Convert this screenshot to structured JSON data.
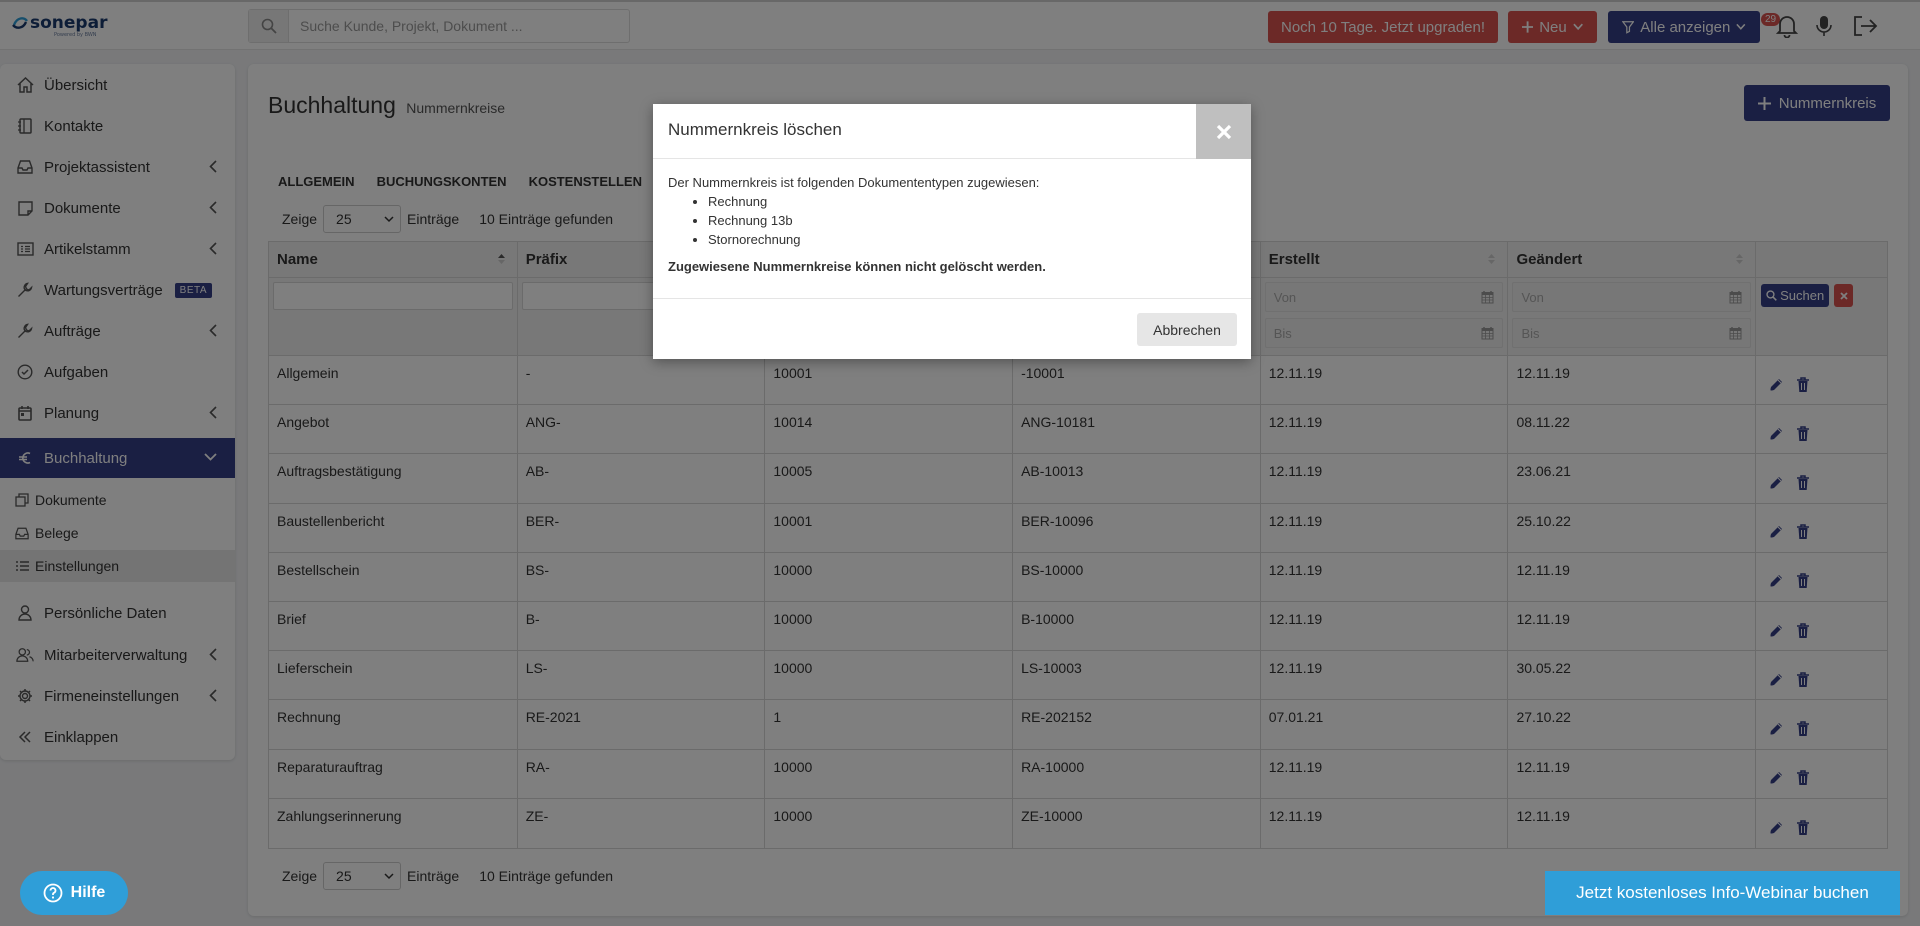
{
  "app": {
    "logo": "sonepar",
    "logo_sub": "Powered by BWN"
  },
  "search": {
    "placeholder": "Suche Kunde, Projekt, Dokument ..."
  },
  "topbar": {
    "upgrade_label": "Noch 10 Tage. Jetzt upgraden!",
    "new_label": "Neu",
    "filter_label": "Alle anzeigen",
    "notification_count": "29"
  },
  "sidebar": {
    "items": [
      {
        "label": "Übersicht",
        "icon": "home-icon"
      },
      {
        "label": "Kontakte",
        "icon": "address-book-icon"
      },
      {
        "label": "Projektassistent",
        "icon": "inbox-icon"
      },
      {
        "label": "Dokumente",
        "icon": "note-icon"
      },
      {
        "label": "Artikelstamm",
        "icon": "list-icon"
      },
      {
        "label": "Wartungsverträge",
        "icon": "wrench-icon",
        "badge": "BETA"
      },
      {
        "label": "Aufträge",
        "icon": "wrench-icon"
      },
      {
        "label": "Aufgaben",
        "icon": "check-circle-icon"
      },
      {
        "label": "Planung",
        "icon": "calendar-icon"
      },
      {
        "label": "Buchhaltung",
        "icon": "euro-icon"
      }
    ],
    "sub_items": [
      {
        "label": "Dokumente",
        "icon": "copy-icon"
      },
      {
        "label": "Belege",
        "icon": "inbox-icon"
      },
      {
        "label": "Einstellungen",
        "icon": "list-icon"
      }
    ],
    "bottom_items": [
      {
        "label": "Persönliche Daten",
        "icon": "user-icon"
      },
      {
        "label": "Mitarbeiterverwaltung",
        "icon": "users-icon"
      },
      {
        "label": "Firmeneinstellungen",
        "icon": "gear-icon"
      },
      {
        "label": "Einklappen",
        "icon": "double-chevron-left-icon"
      }
    ]
  },
  "page": {
    "title": "Buchhaltung",
    "subtitle": "Nummernkreise",
    "add_label": "Nummernkreis"
  },
  "tabs": [
    "ALLGEMEIN",
    "BUCHUNGSKONTEN",
    "KOSTENSTELLEN"
  ],
  "paging": {
    "show_label": "Zeige",
    "page_size": "25",
    "entries_label": "Einträge",
    "found_label": "10 Einträge gefunden"
  },
  "table": {
    "headers": [
      "Name",
      "Präfix",
      "",
      "",
      "Erstellt",
      "Geändert"
    ],
    "filter": {
      "from_placeholder": "Von",
      "to_placeholder": "Bis",
      "search_label": "Suchen"
    },
    "rows": [
      [
        "Allgemein",
        "-",
        "10001",
        "-10001",
        "12.11.19",
        "12.11.19"
      ],
      [
        "Angebot",
        "ANG-",
        "10014",
        "ANG-10181",
        "12.11.19",
        "08.11.22"
      ],
      [
        "Auftragsbestätigung",
        "AB-",
        "10005",
        "AB-10013",
        "12.11.19",
        "23.06.21"
      ],
      [
        "Baustellenbericht",
        "BER-",
        "10001",
        "BER-10096",
        "12.11.19",
        "25.10.22"
      ],
      [
        "Bestellschein",
        "BS-",
        "10000",
        "BS-10000",
        "12.11.19",
        "12.11.19"
      ],
      [
        "Brief",
        "B-",
        "10000",
        "B-10000",
        "12.11.19",
        "12.11.19"
      ],
      [
        "Lieferschein",
        "LS-",
        "10000",
        "LS-10003",
        "12.11.19",
        "30.05.22"
      ],
      [
        "Rechnung",
        "RE-2021",
        "1",
        "RE-202152",
        "07.01.21",
        "27.10.22"
      ],
      [
        "Reparaturauftrag",
        "RA-",
        "10000",
        "RA-10000",
        "12.11.19",
        "12.11.19"
      ],
      [
        "Zahlungserinnerung",
        "ZE-",
        "10000",
        "ZE-10000",
        "12.11.19",
        "12.11.19"
      ]
    ]
  },
  "help_label": "Hilfe",
  "webinar_label": "Jetzt kostenloses Info-Webinar buchen",
  "modal": {
    "title": "Nummernkreis löschen",
    "intro": "Der Nummernkreis ist folgenden Dokumententypen zugewiesen:",
    "types": [
      "Rechnung",
      "Rechnung 13b",
      "Stornorechnung"
    ],
    "warning": "Zugewiesene Nummernkreise können nicht gelöscht werden.",
    "cancel_label": "Abbrechen"
  },
  "colors": {
    "primary": "#353f87",
    "danger": "#d9534f",
    "info": "#2f9ed8"
  }
}
